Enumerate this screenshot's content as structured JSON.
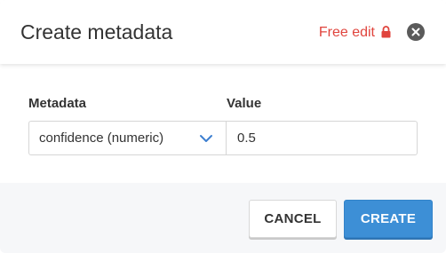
{
  "dialog": {
    "title": "Create metadata",
    "mode_label": "Free edit",
    "mode_icon": "lock-icon",
    "close_icon": "close-icon"
  },
  "form": {
    "metadata_label": "Metadata",
    "value_label": "Value",
    "metadata_selected": "confidence (numeric)",
    "value": "0.5"
  },
  "footer": {
    "cancel_label": "CANCEL",
    "create_label": "CREATE"
  },
  "colors": {
    "accent": "#3d8fd6",
    "warning": "#e0443d"
  }
}
